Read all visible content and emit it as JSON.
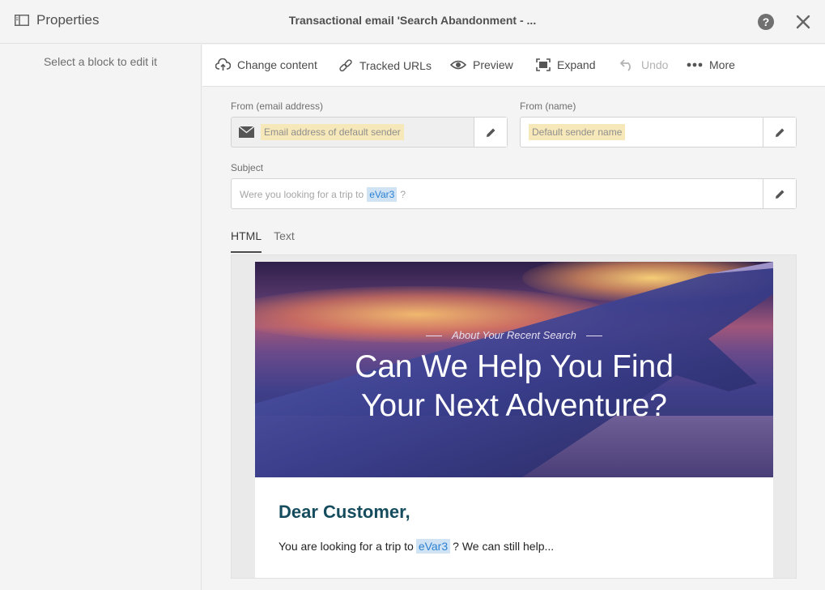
{
  "header": {
    "panel_title": "Properties",
    "doc_title": "Transactional email 'Search Abandonment - ...",
    "help_label": "?"
  },
  "sidebar": {
    "hint": "Select a block to edit it"
  },
  "toolbar": {
    "change_content": "Change content",
    "tracked_urls": "Tracked URLs",
    "preview": "Preview",
    "expand": "Expand",
    "undo": "Undo",
    "more": "More"
  },
  "form": {
    "from_email_label": "From (email address)",
    "from_email_value": "Email address of default sender",
    "from_name_label": "From (name)",
    "from_name_value": "Default sender name",
    "subject_label": "Subject",
    "subject_prefix": "Were you looking for a trip to",
    "subject_token": "eVar3",
    "subject_suffix": "?"
  },
  "tabs": [
    {
      "label": "HTML",
      "active": true
    },
    {
      "label": "Text",
      "active": false
    }
  ],
  "email": {
    "kicker": "About Your Recent Search",
    "title_line1": "Can We Help You Find",
    "title_line2": "Your Next Adventure?",
    "greeting": "Dear Customer,",
    "body_prefix": "You are looking for a trip to",
    "body_token": "eVar3",
    "body_suffix": "? We can still help..."
  },
  "colors": {
    "greeting": "#164d5e",
    "token_bg": "#cfe3f5",
    "token_text": "#2d80d1",
    "sender_tag_bg": "#f6e8b8"
  }
}
